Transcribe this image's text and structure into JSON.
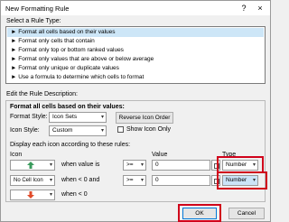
{
  "window": {
    "title": "New Formatting Rule",
    "help": "?",
    "close": "×"
  },
  "rule_type": {
    "label": "Select a Rule Type:",
    "items": [
      {
        "label": "► Format all cells based on their values",
        "selected": true
      },
      {
        "label": "► Format only cells that contain",
        "selected": false
      },
      {
        "label": "► Format only top or bottom ranked values",
        "selected": false
      },
      {
        "label": "► Format only values that are above or below average",
        "selected": false
      },
      {
        "label": "► Format only unique or duplicate values",
        "selected": false
      },
      {
        "label": "► Use a formula to determine which cells to format",
        "selected": false
      }
    ]
  },
  "description": {
    "label": "Edit the Rule Description:",
    "heading": "Format all cells based on their values:",
    "format_style_label": "Format Style:",
    "format_style_value": "Icon Sets",
    "reverse_button": "Reverse Icon Order",
    "icon_style_label": "Icon Style:",
    "icon_style_value": "Custom",
    "show_icon_only": "Show Icon Only",
    "display_text": "Display each icon according to these rules:",
    "col_icon": "Icon",
    "col_value": "Value",
    "col_type": "Type",
    "rules": [
      {
        "icon": "green-up-arrow",
        "icon_text": "",
        "cond": "when value is",
        "op": ">=",
        "value": "0",
        "type": "Number"
      },
      {
        "icon": "none",
        "icon_text": "No Cell Icon",
        "cond": "when < 0 and",
        "op": ">=",
        "value": "0",
        "type": "Number"
      },
      {
        "icon": "red-down-arrow",
        "icon_text": "",
        "cond": "when < 0",
        "op": "",
        "value": "",
        "type": ""
      }
    ]
  },
  "footer": {
    "ok": "OK",
    "cancel": "Cancel"
  },
  "colors": {
    "highlight": "#d0021b",
    "green_arrow": "#3a9b5c",
    "red_arrow": "#e04b2a"
  }
}
